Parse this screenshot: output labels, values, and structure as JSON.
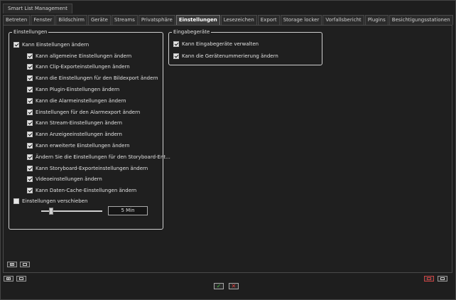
{
  "window": {
    "title": "Smart List Management"
  },
  "tabs": [
    {
      "label": "Betreten",
      "active": false
    },
    {
      "label": "Fenster",
      "active": false
    },
    {
      "label": "Bildschirm",
      "active": false
    },
    {
      "label": "Geräte",
      "active": false
    },
    {
      "label": "Streams",
      "active": false
    },
    {
      "label": "Privatsphäre",
      "active": false
    },
    {
      "label": "Einstellungen",
      "active": true
    },
    {
      "label": "Lesezeichen",
      "active": false
    },
    {
      "label": "Export",
      "active": false
    },
    {
      "label": "Storage locker",
      "active": false
    },
    {
      "label": "Vorfallsbericht",
      "active": false
    },
    {
      "label": "Plugins",
      "active": false
    },
    {
      "label": "Besichtigungsstationen",
      "active": false
    }
  ],
  "settings_group": {
    "title": "Einstellungen",
    "master": {
      "label": "Kann Einstellungen ändern",
      "checked": true
    },
    "items": [
      {
        "label": "Kann allgemeine Einstellungen ändern",
        "checked": true
      },
      {
        "label": "Kann Clip-Exporteinstellungen ändern",
        "checked": true
      },
      {
        "label": "Kann die Einstellungen für den Bildexport ändern",
        "checked": true
      },
      {
        "label": "Kann Plugin-Einstellungen ändern",
        "checked": true
      },
      {
        "label": "Kann die Alarmeinstellungen ändern",
        "checked": true
      },
      {
        "label": "Einstellungen für den Alarmexport ändern",
        "checked": true
      },
      {
        "label": "Kann Stream-Einstellungen ändern",
        "checked": true
      },
      {
        "label": "Kann Anzeigeeinstellungen ändern",
        "checked": true
      },
      {
        "label": "Kann erweiterte Einstellungen ändern",
        "checked": true
      },
      {
        "label": "Ändern Sie die Einstellungen für den Storyboard-Ent...",
        "checked": true
      },
      {
        "label": "Kann Storyboard-Exporteinstellungen ändern",
        "checked": true
      },
      {
        "label": "Videoeinstellungen ändern",
        "checked": true
      },
      {
        "label": "Kann Daten-Cache-Einstellungen ändern",
        "checked": true
      }
    ],
    "shift": {
      "label": "Einstellungen verschieben",
      "checked": false
    },
    "slider": {
      "value_text": "5 Min",
      "fraction": 0.06
    }
  },
  "devices_group": {
    "title": "Eingabegeräte",
    "items": [
      {
        "label": "Kann Eingabegeräte verwalten",
        "checked": true
      },
      {
        "label": "Kann die Gerätenummerierung ändern",
        "checked": true
      }
    ]
  },
  "icons": {
    "select_all": "check-all-icon",
    "select_none": "uncheck-all-icon",
    "ok": "checkmark-icon",
    "cancel": "x-icon"
  },
  "colors": {
    "ok": "#3fbf3f",
    "cancel": "#e04040"
  }
}
